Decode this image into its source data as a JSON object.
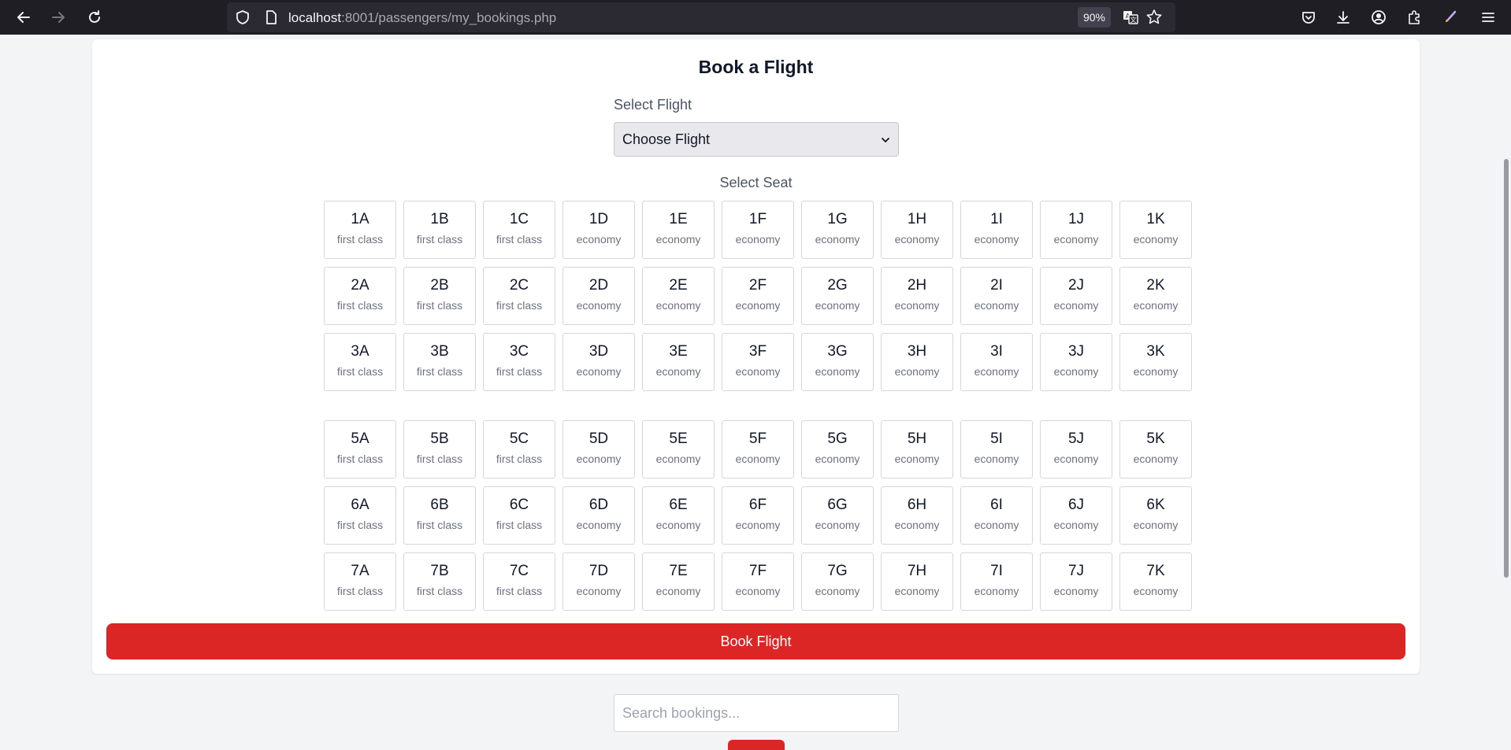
{
  "browser": {
    "url_host": "localhost",
    "url_path": ":8001/passengers/my_bookings.php",
    "zoom": "90%"
  },
  "icons": {
    "back": "arrow-left-icon",
    "forward": "arrow-right-icon",
    "reload": "reload-icon",
    "shield": "shield-icon",
    "page": "page-icon",
    "translate": "translate-icon",
    "bookmark": "star-icon",
    "pocket": "pocket-icon",
    "downloads": "download-icon",
    "account": "account-icon",
    "extensions": "puzzle-icon",
    "customize": "brush-icon",
    "menu": "hamburger-menu-icon"
  },
  "booking": {
    "title": "Book a Flight",
    "flight_label": "Select Flight",
    "flight_selected": "Choose Flight",
    "seat_label": "Select Seat",
    "book_button": "Book Flight"
  },
  "seat_rows": [
    {
      "row": "1",
      "seats": [
        {
          "id": "1A",
          "cls": "first class"
        },
        {
          "id": "1B",
          "cls": "first class"
        },
        {
          "id": "1C",
          "cls": "first class"
        },
        {
          "id": "1D",
          "cls": "economy"
        },
        {
          "id": "1E",
          "cls": "economy"
        },
        {
          "id": "1F",
          "cls": "economy"
        },
        {
          "id": "1G",
          "cls": "economy"
        },
        {
          "id": "1H",
          "cls": "economy"
        },
        {
          "id": "1I",
          "cls": "economy"
        },
        {
          "id": "1J",
          "cls": "economy"
        },
        {
          "id": "1K",
          "cls": "economy"
        }
      ]
    },
    {
      "row": "2",
      "seats": [
        {
          "id": "2A",
          "cls": "first class"
        },
        {
          "id": "2B",
          "cls": "first class"
        },
        {
          "id": "2C",
          "cls": "first class"
        },
        {
          "id": "2D",
          "cls": "economy"
        },
        {
          "id": "2E",
          "cls": "economy"
        },
        {
          "id": "2F",
          "cls": "economy"
        },
        {
          "id": "2G",
          "cls": "economy"
        },
        {
          "id": "2H",
          "cls": "economy"
        },
        {
          "id": "2I",
          "cls": "economy"
        },
        {
          "id": "2J",
          "cls": "economy"
        },
        {
          "id": "2K",
          "cls": "economy"
        }
      ]
    },
    {
      "row": "3",
      "seats": [
        {
          "id": "3A",
          "cls": "first class"
        },
        {
          "id": "3B",
          "cls": "first class"
        },
        {
          "id": "3C",
          "cls": "first class"
        },
        {
          "id": "3D",
          "cls": "economy"
        },
        {
          "id": "3E",
          "cls": "economy"
        },
        {
          "id": "3F",
          "cls": "economy"
        },
        {
          "id": "3G",
          "cls": "economy"
        },
        {
          "id": "3H",
          "cls": "economy"
        },
        {
          "id": "3I",
          "cls": "economy"
        },
        {
          "id": "3J",
          "cls": "economy"
        },
        {
          "id": "3K",
          "cls": "economy"
        }
      ]
    },
    {
      "row": "5",
      "seats": [
        {
          "id": "5A",
          "cls": "first class"
        },
        {
          "id": "5B",
          "cls": "first class"
        },
        {
          "id": "5C",
          "cls": "first class"
        },
        {
          "id": "5D",
          "cls": "economy"
        },
        {
          "id": "5E",
          "cls": "economy"
        },
        {
          "id": "5F",
          "cls": "economy"
        },
        {
          "id": "5G",
          "cls": "economy"
        },
        {
          "id": "5H",
          "cls": "economy"
        },
        {
          "id": "5I",
          "cls": "economy"
        },
        {
          "id": "5J",
          "cls": "economy"
        },
        {
          "id": "5K",
          "cls": "economy"
        }
      ]
    },
    {
      "row": "6",
      "seats": [
        {
          "id": "6A",
          "cls": "first class"
        },
        {
          "id": "6B",
          "cls": "first class"
        },
        {
          "id": "6C",
          "cls": "first class"
        },
        {
          "id": "6D",
          "cls": "economy"
        },
        {
          "id": "6E",
          "cls": "economy"
        },
        {
          "id": "6F",
          "cls": "economy"
        },
        {
          "id": "6G",
          "cls": "economy"
        },
        {
          "id": "6H",
          "cls": "economy"
        },
        {
          "id": "6I",
          "cls": "economy"
        },
        {
          "id": "6J",
          "cls": "economy"
        },
        {
          "id": "6K",
          "cls": "economy"
        }
      ]
    },
    {
      "row": "7",
      "seats": [
        {
          "id": "7A",
          "cls": "first class"
        },
        {
          "id": "7B",
          "cls": "first class"
        },
        {
          "id": "7C",
          "cls": "first class"
        },
        {
          "id": "7D",
          "cls": "economy"
        },
        {
          "id": "7E",
          "cls": "economy"
        },
        {
          "id": "7F",
          "cls": "economy"
        },
        {
          "id": "7G",
          "cls": "economy"
        },
        {
          "id": "7H",
          "cls": "economy"
        },
        {
          "id": "7I",
          "cls": "economy"
        },
        {
          "id": "7J",
          "cls": "economy"
        },
        {
          "id": "7K",
          "cls": "economy"
        }
      ]
    }
  ],
  "search": {
    "placeholder": "Search bookings..."
  },
  "colors": {
    "accent": "#dc2626",
    "page_bg": "#f3f4f6",
    "chrome_bg": "#1f1e25"
  }
}
